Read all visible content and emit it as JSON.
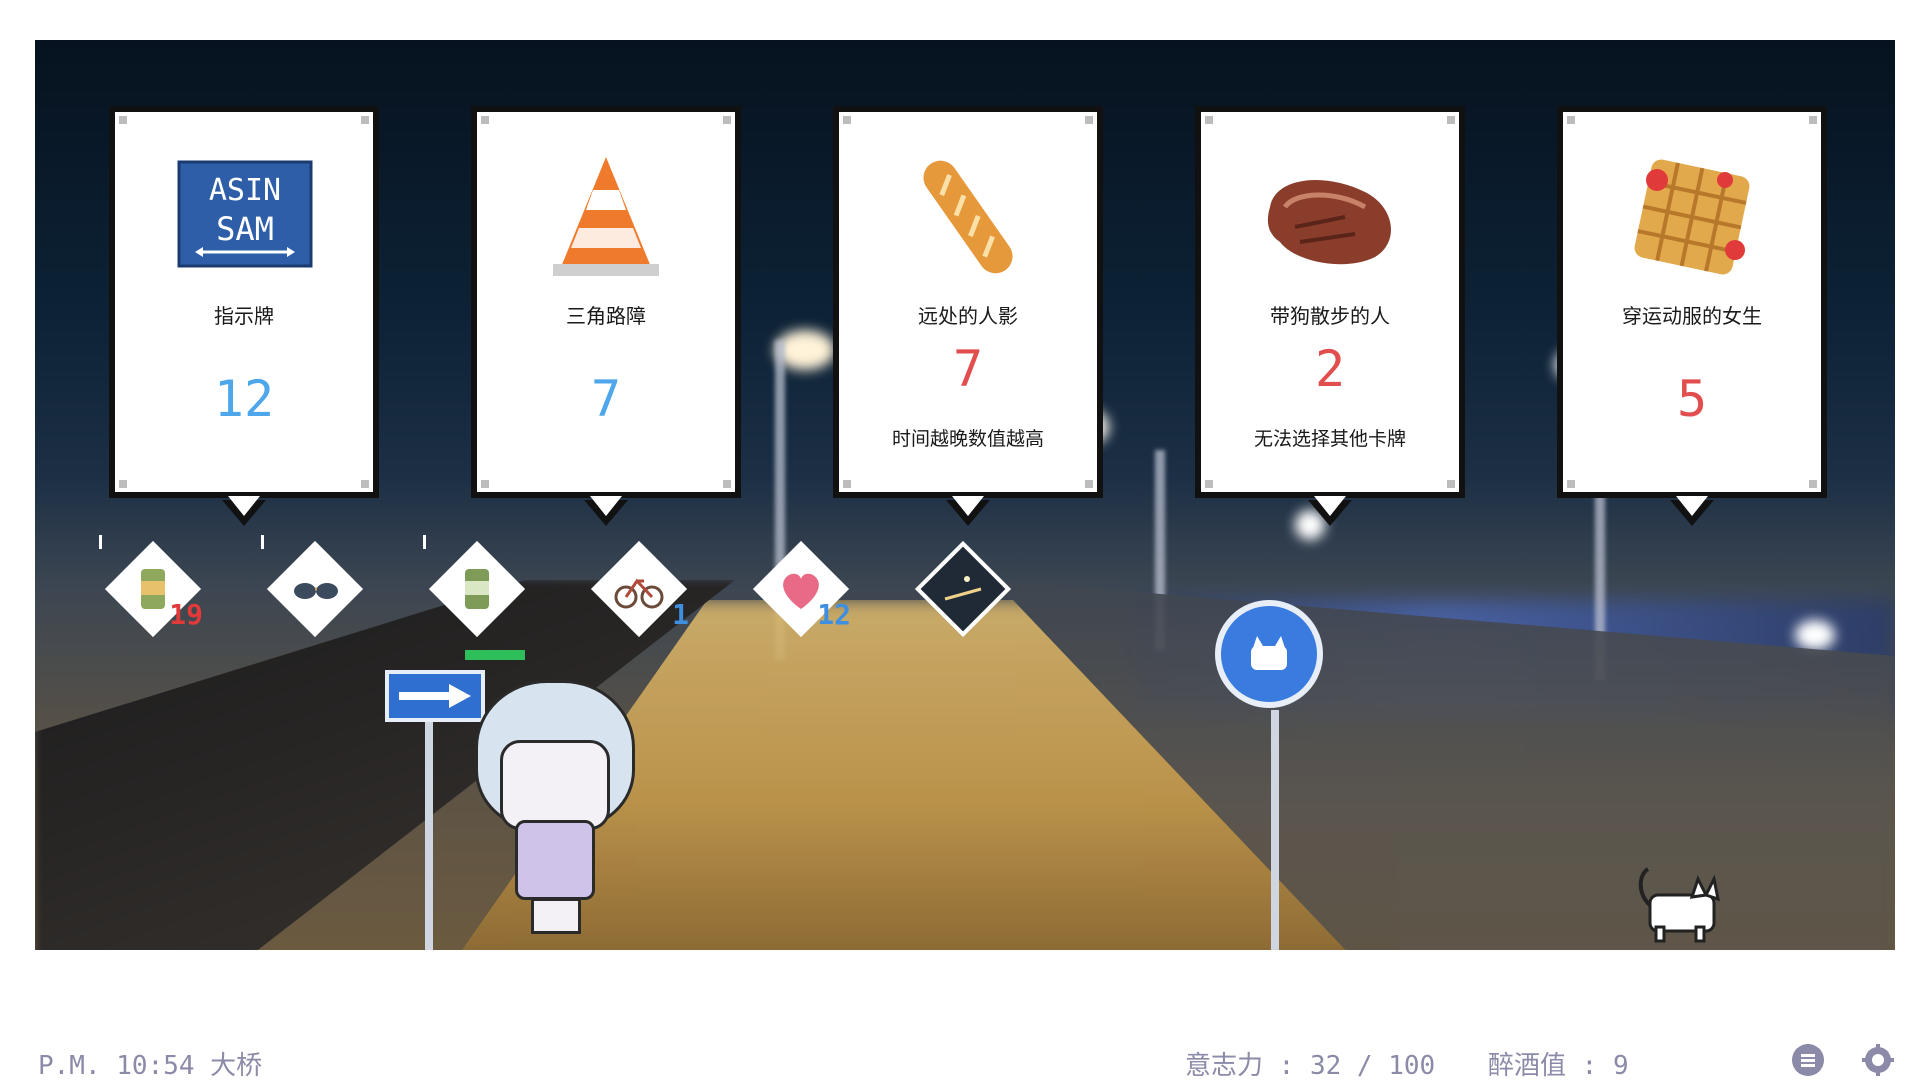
{
  "cards": [
    {
      "name": "指示牌",
      "value": "12",
      "note": "",
      "value_color": "blue",
      "art": "sign-icon",
      "sign_text": [
        "ASIN",
        "SAM"
      ]
    },
    {
      "name": "三角路障",
      "value": "7",
      "note": "",
      "value_color": "blue",
      "art": "traffic-cone-icon"
    },
    {
      "name": "远处的人影",
      "value": "7",
      "note": "时间越晚数值越高",
      "value_color": "red",
      "art": "baguette-icon"
    },
    {
      "name": "带狗散步的人",
      "value": "2",
      "note": "无法选择其他卡牌",
      "value_color": "red",
      "art": "steak-icon"
    },
    {
      "name": "穿运动服的女生",
      "value": "5",
      "note": "",
      "value_color": "red",
      "art": "waffle-icon"
    }
  ],
  "items": [
    {
      "icon": "beer-can-icon",
      "count": "19",
      "count_color": "#e23a3a"
    },
    {
      "icon": "sunglasses-icon",
      "count": ""
    },
    {
      "icon": "beer-can-icon",
      "count": ""
    },
    {
      "icon": "bicycle-icon",
      "count": "1",
      "count_color": "#3f8fe0"
    },
    {
      "icon": "heart-icon",
      "count": "12",
      "count_color": "#3f8fe0"
    },
    {
      "icon": "night-bridge-icon",
      "count": ""
    }
  ],
  "status": {
    "time_location": "P.M. 10:54 大桥",
    "willpower": "意志力 : 32 / 100",
    "drunk": "醉酒值 : 9"
  },
  "colors": {
    "value_blue": "#4da7ea",
    "value_red": "#e24d4d",
    "status_text": "#8b8aa8",
    "sign_blue": "#3f7fd6"
  },
  "character": {
    "hp_fraction": 1.0
  }
}
